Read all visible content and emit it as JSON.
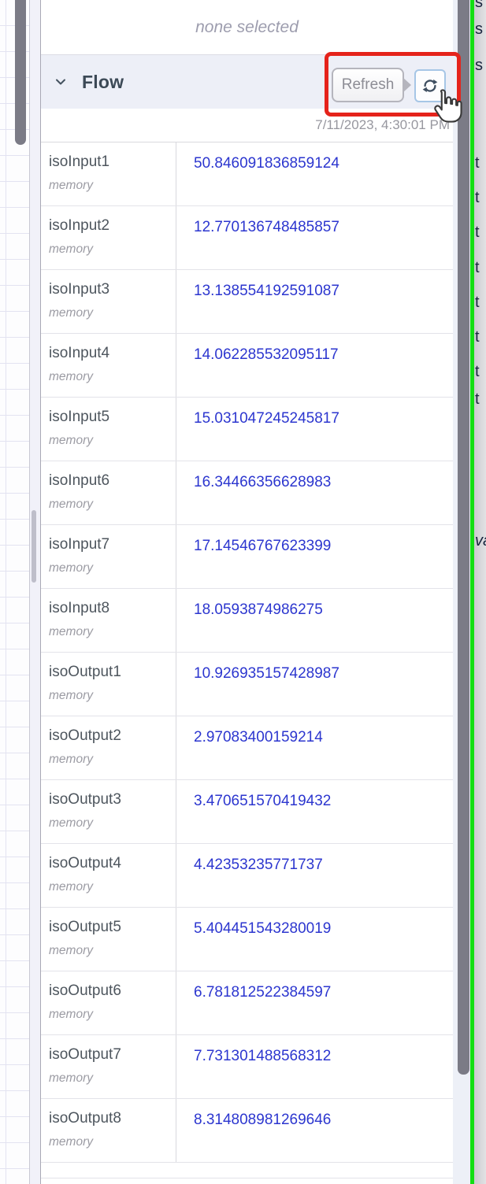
{
  "selection_status": "none selected",
  "flow_section": {
    "title": "Flow",
    "refresh_button_label": "Refresh",
    "last_refresh_timestamp": "7/11/2023, 4:30:01 PM",
    "type_label": "memory",
    "rows": [
      {
        "name": "isoInput1",
        "type": "memory",
        "value": "50.846091836859124"
      },
      {
        "name": "isoInput2",
        "type": "memory",
        "value": "12.770136748485857"
      },
      {
        "name": "isoInput3",
        "type": "memory",
        "value": "13.138554192591087"
      },
      {
        "name": "isoInput4",
        "type": "memory",
        "value": "14.062285532095117"
      },
      {
        "name": "isoInput5",
        "type": "memory",
        "value": "15.031047245245817"
      },
      {
        "name": "isoInput6",
        "type": "memory",
        "value": "16.34466356628983"
      },
      {
        "name": "isoInput7",
        "type": "memory",
        "value": "17.14546767623399"
      },
      {
        "name": "isoInput8",
        "type": "memory",
        "value": "18.0593874986275"
      },
      {
        "name": "isoOutput1",
        "type": "memory",
        "value": "10.926935157428987"
      },
      {
        "name": "isoOutput2",
        "type": "memory",
        "value": "2.97083400159214"
      },
      {
        "name": "isoOutput3",
        "type": "memory",
        "value": "3.470651570419432"
      },
      {
        "name": "isoOutput4",
        "type": "memory",
        "value": "4.42353235771737"
      },
      {
        "name": "isoOutput5",
        "type": "memory",
        "value": "5.404451543280019"
      },
      {
        "name": "isoOutput6",
        "type": "memory",
        "value": "6.781812522384597"
      },
      {
        "name": "isoOutput7",
        "type": "memory",
        "value": "7.731301488568312"
      },
      {
        "name": "isoOutput8",
        "type": "memory",
        "value": "8.314808981269646"
      }
    ]
  },
  "right_panel_fragments": [
    {
      "text": "s",
      "italic": false
    },
    {
      "text": "s",
      "italic": false
    },
    {
      "text": "s",
      "italic": false
    },
    {
      "text": "t",
      "italic": false
    },
    {
      "text": "t",
      "italic": false
    },
    {
      "text": "t",
      "italic": false
    },
    {
      "text": "t",
      "italic": false
    },
    {
      "text": "t",
      "italic": false
    },
    {
      "text": "t",
      "italic": false
    },
    {
      "text": "t",
      "italic": false
    },
    {
      "text": "t",
      "italic": false
    },
    {
      "text": "va",
      "italic": true
    }
  ],
  "colors": {
    "value_blue": "#2c36cf",
    "highlight_red": "#e5231b",
    "selection_green": "#12df12",
    "scrollbar_gray": "#7b7b86",
    "header_lavender": "#edeff7"
  }
}
